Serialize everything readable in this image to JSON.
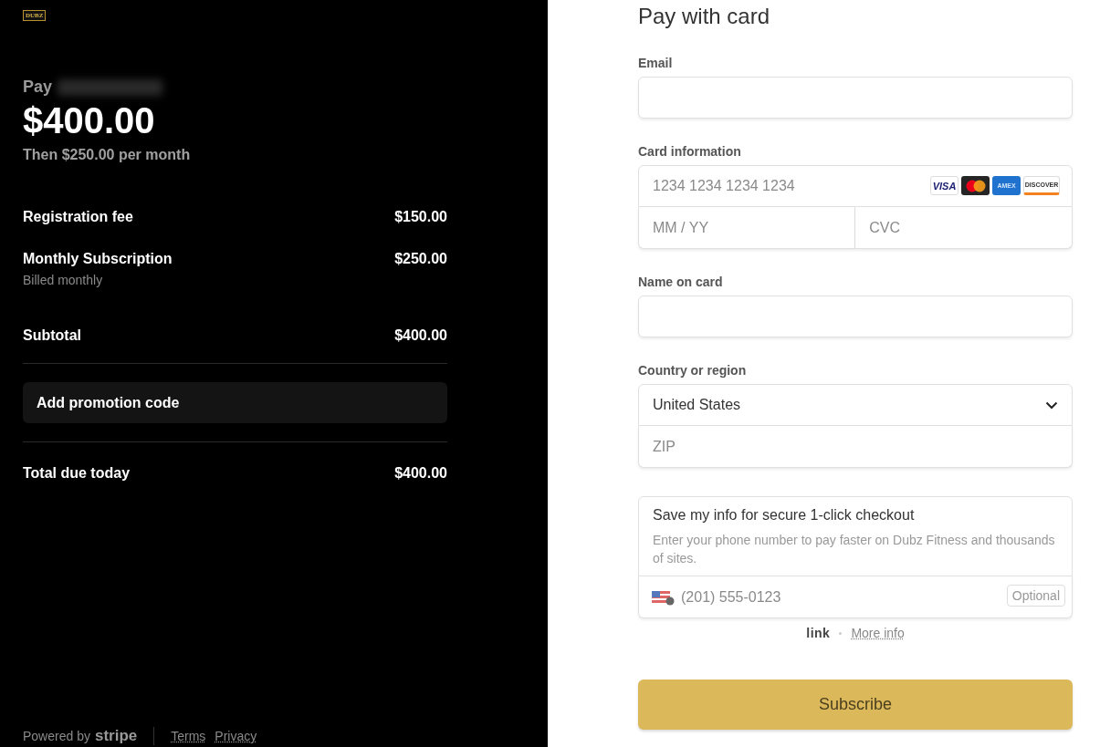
{
  "brand": {
    "logo": "DUBZ"
  },
  "summary": {
    "pay_label": "Pay",
    "amount": "$400.00",
    "recurring": "Then $250.00 per month",
    "line_items": [
      {
        "name": "Registration fee",
        "price": "$150.00"
      },
      {
        "name": "Monthly Subscription",
        "price": "$250.00",
        "note": "Billed monthly"
      }
    ],
    "subtotal": {
      "label": "Subtotal",
      "value": "$400.00"
    },
    "promo_button": "Add promotion code",
    "total": {
      "label": "Total due today",
      "value": "$400.00"
    }
  },
  "footer": {
    "powered_by": "Powered by",
    "stripe": "stripe",
    "links": [
      "Terms",
      "Privacy"
    ]
  },
  "form": {
    "title": "Pay with card",
    "email": {
      "label": "Email"
    },
    "card": {
      "label": "Card information",
      "number_placeholder": "1234 1234 1234 1234",
      "brands": [
        {
          "kind": "visa",
          "label": "VISA"
        },
        {
          "kind": "mastercard"
        },
        {
          "kind": "amex",
          "label": "AMEX"
        },
        {
          "kind": "discover",
          "label": "DISCOVER"
        }
      ],
      "expiry_placeholder": "MM / YY",
      "cvc_placeholder": "CVC"
    },
    "name": {
      "label": "Name on card"
    },
    "country": {
      "label": "Country or region",
      "value": "United States",
      "zip_placeholder": "ZIP"
    },
    "link_box": {
      "title": "Save my info for secure 1-click checkout",
      "description": "Enter your phone number to pay faster on Dubz Fitness and thousands of sites.",
      "phone_placeholder": "(201) 555-0123",
      "optional": "Optional"
    },
    "link_brand": "link",
    "more_info": "More info",
    "submit": "Subscribe"
  }
}
